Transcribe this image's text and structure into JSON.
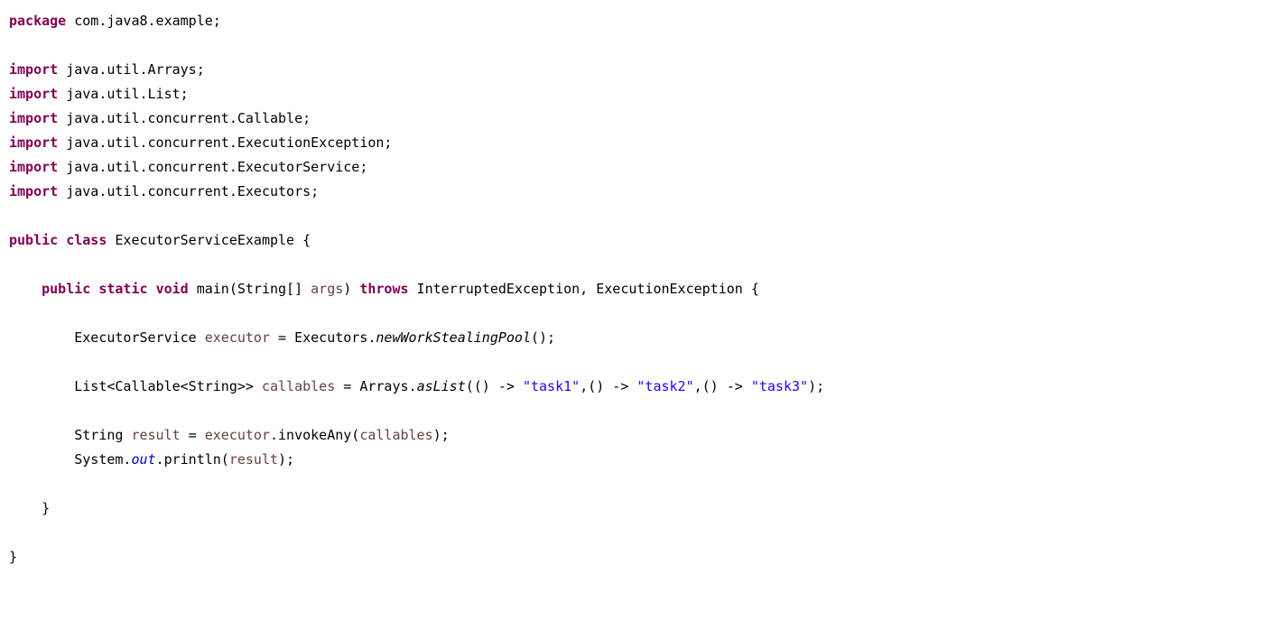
{
  "lines": {
    "l1_kw": "package",
    "l1_txt": " com.java8.example;",
    "l2": "",
    "l3_kw": "import",
    "l3_txt": " java.util.Arrays;",
    "l4_kw": "import",
    "l4_txt": " java.util.List;",
    "l5_kw": "import",
    "l5_txt": " java.util.concurrent.Callable;",
    "l6_kw": "import",
    "l6_txt": " java.util.concurrent.ExecutionException;",
    "l7_kw": "import",
    "l7_txt": " java.util.concurrent.ExecutorService;",
    "l8_kw": "import",
    "l8_txt": " java.util.concurrent.Executors;",
    "l9": "",
    "l10_kw1": "public",
    "l10_sp1": " ",
    "l10_kw2": "class",
    "l10_txt": " ExecutorServiceExample {",
    "l11": "",
    "l12_indent": "    ",
    "l12_kw1": "public",
    "l12_sp1": " ",
    "l12_kw2": "static",
    "l12_sp2": " ",
    "l12_kw3": "void",
    "l12_txt1": " main(String[] ",
    "l12_id1": "args",
    "l12_txt2": ") ",
    "l12_kw4": "throws",
    "l12_txt3": " InterruptedException, ExecutionException {",
    "l13": "",
    "l14_indent": "        ",
    "l14_txt1": "ExecutorService ",
    "l14_id1": "executor",
    "l14_txt2": " = Executors.",
    "l14_static": "newWorkStealingPool",
    "l14_txt3": "();",
    "l15": "",
    "l16_indent": "        ",
    "l16_txt1": "List<Callable<String>> ",
    "l16_id1": "callables",
    "l16_txt2": " = Arrays.",
    "l16_static": "asList",
    "l16_txt3": "(() -> ",
    "l16_str1": "\"task1\"",
    "l16_txt4": ",() -> ",
    "l16_str2": "\"task2\"",
    "l16_txt5": ",() -> ",
    "l16_str3": "\"task3\"",
    "l16_txt6": ");",
    "l17": "",
    "l18_indent": "        ",
    "l18_txt1": "String ",
    "l18_id1": "result",
    "l18_txt2": " = ",
    "l18_id2": "executor",
    "l18_txt3": ".invokeAny(",
    "l18_id3": "callables",
    "l18_txt4": ");",
    "l19_indent": "        ",
    "l19_txt1": "System.",
    "l19_sf": "out",
    "l19_txt2": ".println(",
    "l19_id1": "result",
    "l19_txt3": ");",
    "l20": "",
    "l21": "    }",
    "l22": "",
    "l23": "}"
  }
}
